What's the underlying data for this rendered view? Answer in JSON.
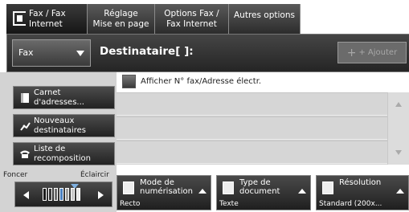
{
  "tabs": [
    {
      "line1": "Fax / Fax",
      "line2": "Internet"
    },
    {
      "line1": "Réglage",
      "line2": "Mise en page"
    },
    {
      "line1": "Options Fax /",
      "line2": "Fax Internet"
    },
    {
      "line1": "Autres options",
      "line2": ""
    }
  ],
  "faxbar": {
    "fax_select": "Fax",
    "destination": "Destinataire[   ]:",
    "add_button": "Ajouter"
  },
  "show_fax_checkbox": "Afficher N° fax/Adresse électr.",
  "left_buttons": [
    {
      "line1": "Carnet",
      "line2": "d'adresses..."
    },
    {
      "line1": "Nouveaux",
      "line2": "destinataires"
    },
    {
      "line1": "Liste de",
      "line2": "recomposition"
    }
  ],
  "density": {
    "label_dark": "Foncer",
    "label_light": "Éclaircir"
  },
  "features": [
    {
      "title1": "Mode de",
      "title2": "numérisation",
      "value": "Recto"
    },
    {
      "title1": "Type de",
      "title2": "document",
      "value": "Texte"
    },
    {
      "title1": "Résolution",
      "title2": "",
      "value": "Standard (200x..."
    }
  ]
}
